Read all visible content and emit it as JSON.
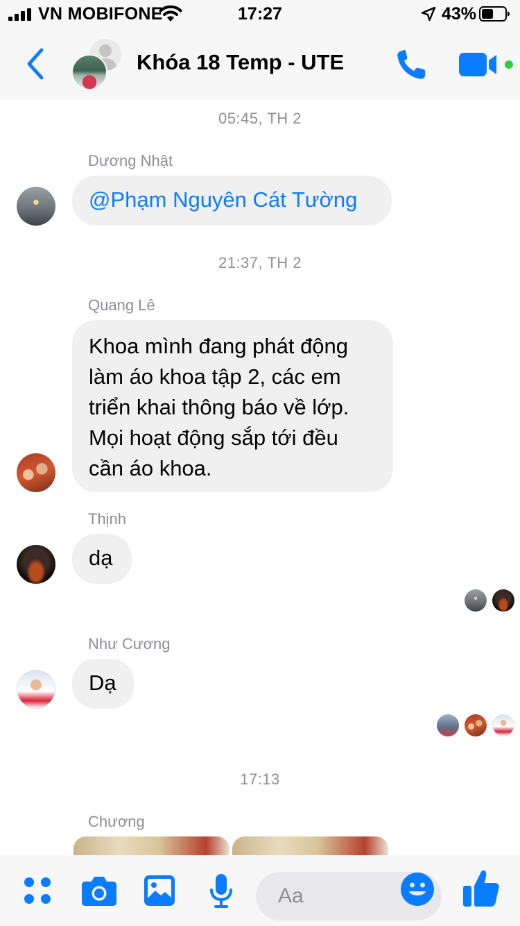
{
  "status_bar": {
    "carrier": "VN MOBIFONE",
    "time": "17:27",
    "battery": "43%"
  },
  "header": {
    "title": "Khóa 18 Temp - UTE"
  },
  "messages": [
    {
      "timestamp": "05:45, TH 2"
    },
    {
      "sender": "Dương Nhật",
      "text": "@Phạm Nguyên Cát Tường"
    },
    {
      "timestamp": "21:37, TH 2"
    },
    {
      "sender": "Quang Lê",
      "lines": [
        "Khoa mình đang phát động",
        "làm áo khoa tập 2, các em",
        "triển khai thông báo về lớp.",
        "Mọi hoạt động sắp tới đều",
        "cần áo khoa."
      ]
    },
    {
      "sender": "Thịnh",
      "text": "dạ"
    },
    {
      "sender": "Như Cương",
      "text": "Dạ"
    },
    {
      "timestamp": "17:13"
    },
    {
      "sender": "Chương"
    }
  ],
  "composer": {
    "placeholder": "Aa"
  },
  "colors": {
    "accent": "#0a7cff",
    "bubble": "#f0f0f0",
    "meta_text": "#8e8e93",
    "online": "#31cc46"
  },
  "icons": [
    "back-icon",
    "phone-icon",
    "video-camera-icon",
    "apps-grid-icon",
    "camera-icon",
    "image-icon",
    "microphone-icon",
    "emoji-icon",
    "thumbs-up-icon"
  ]
}
